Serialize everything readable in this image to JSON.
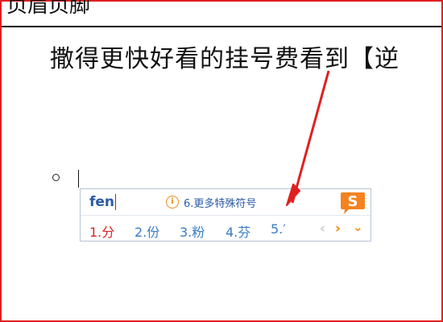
{
  "document": {
    "header_text": "页眉页脚",
    "body_line": "撒得更快好看的挂号费看到【逆"
  },
  "ime": {
    "pinyin": "fen",
    "hint_number": "6.",
    "hint_label": "更多特殊符号",
    "info_icon_glyph": "i",
    "logo_letter": "S",
    "candidates": [
      {
        "index": "1.",
        "text": "分"
      },
      {
        "index": "2.",
        "text": "份"
      },
      {
        "index": "3.",
        "text": "粉"
      },
      {
        "index": "4.",
        "text": "芬"
      },
      {
        "index": "5.",
        "text": "′"
      }
    ],
    "nav_prev": "‹",
    "nav_next": "›",
    "nav_expand": "⌄",
    "colors": {
      "pinyin": "#2a5aa8",
      "candidate_selected": "#e02020",
      "candidate": "#3a7cc4",
      "accent": "#f08a18",
      "annotation": "#e02020"
    }
  }
}
